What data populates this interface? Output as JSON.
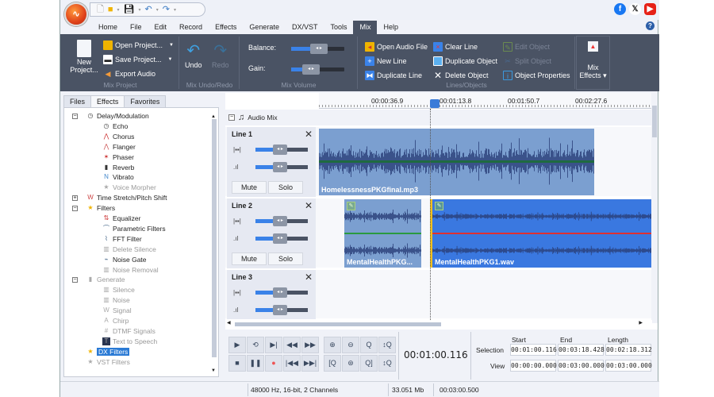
{
  "titlebar": {
    "qat_icons": [
      "new-file-icon",
      "open-folder-icon",
      "save-icon",
      "undo-icon",
      "redo-icon"
    ],
    "social": [
      "facebook",
      "x",
      "youtube"
    ]
  },
  "menu": {
    "items": [
      "Home",
      "File",
      "Edit",
      "Record",
      "Effects",
      "Generate",
      "DX/VST",
      "Tools",
      "Mix",
      "Help"
    ],
    "active": "Mix"
  },
  "ribbon": {
    "mix_project": {
      "new": "New Project...",
      "open": "Open Project...",
      "save": "Save Project...",
      "export": "Export Audio",
      "label": "Mix Project"
    },
    "undo_redo": {
      "undo": "Undo",
      "redo": "Redo",
      "label": "Mix Undo/Redo"
    },
    "mix_volume": {
      "balance": "Balance:",
      "gain": "Gain:",
      "label": "Mix Volume",
      "balance_value": 0.5,
      "gain_value": 0.4
    },
    "lines_objects": {
      "open_audio": "Open Audio File",
      "new_line": "New Line",
      "dup_line": "Duplicate Line",
      "clear_line": "Clear Line",
      "dup_object": "Duplicate Object",
      "delete_object": "Delete Object",
      "edit_object": "Edit Object",
      "split_object": "Split Object",
      "object_props": "Object Properties",
      "label": "Lines/Objects"
    },
    "mix_effects": {
      "line1": "Mix",
      "line2": "Effects ▾"
    }
  },
  "left": {
    "tabs": [
      "Files",
      "Effects",
      "Favorites"
    ],
    "active_tab": "Effects",
    "tree": [
      {
        "label": "Delay/Modulation",
        "level": 0,
        "icon": "clock-icon",
        "dim": false
      },
      {
        "label": "Echo",
        "level": 1,
        "icon": "clock-icon",
        "dim": false
      },
      {
        "label": "Chorus",
        "level": 1,
        "icon": "chorus-icon",
        "dim": false
      },
      {
        "label": "Flanger",
        "level": 1,
        "icon": "flanger-icon",
        "dim": false
      },
      {
        "label": "Phaser",
        "level": 1,
        "icon": "phaser-icon",
        "dim": false
      },
      {
        "label": "Reverb",
        "level": 1,
        "icon": "reverb-icon",
        "dim": false
      },
      {
        "label": "Vibrato",
        "level": 1,
        "icon": "vibrato-icon",
        "dim": false
      },
      {
        "label": "Voice Morpher",
        "level": 1,
        "icon": "star-icon",
        "dim": true
      },
      {
        "label": "Time Stretch/Pitch Shift",
        "level": 0,
        "icon": "stretch-icon",
        "dim": false
      },
      {
        "label": "Filters",
        "level": 0,
        "icon": "star-icon",
        "dim": false
      },
      {
        "label": "Equalizer",
        "level": 1,
        "icon": "equalizer-icon",
        "dim": false
      },
      {
        "label": "Parametric Filters",
        "level": 1,
        "icon": "parametric-icon",
        "dim": false
      },
      {
        "label": "FFT Filter",
        "level": 1,
        "icon": "fft-icon",
        "dim": false
      },
      {
        "label": "Delete Silence",
        "level": 1,
        "icon": "silence-icon",
        "dim": true
      },
      {
        "label": "Noise Gate",
        "level": 1,
        "icon": "gate-icon",
        "dim": false
      },
      {
        "label": "Noise Removal",
        "level": 1,
        "icon": "noise-icon",
        "dim": true
      },
      {
        "label": "Generate",
        "level": 0,
        "icon": "generate-icon",
        "dim": true
      },
      {
        "label": "Silence",
        "level": 1,
        "icon": "silence-icon",
        "dim": true
      },
      {
        "label": "Noise",
        "level": 1,
        "icon": "noise-icon",
        "dim": true
      },
      {
        "label": "Signal",
        "level": 1,
        "icon": "signal-icon",
        "dim": true
      },
      {
        "label": "Chirp",
        "level": 1,
        "icon": "chirp-icon",
        "dim": true
      },
      {
        "label": "DTMF Signals",
        "level": 1,
        "icon": "hash-icon",
        "dim": true
      },
      {
        "label": "Text to Speech",
        "level": 1,
        "icon": "tts-icon",
        "dim": true
      },
      {
        "label": "DX Filters",
        "level": 0,
        "icon": "dx-icon",
        "dim": false,
        "selected": true
      },
      {
        "label": "VST Filters",
        "level": 0,
        "icon": "vst-icon",
        "dim": true
      }
    ]
  },
  "timeline": {
    "ticks": [
      "00:00:36.9",
      "00:01:13.8",
      "00:01:50.7",
      "00:02:27.6"
    ],
    "audio_mix": "Audio Mix"
  },
  "lines": [
    {
      "name": "Line 1",
      "mute": "Mute",
      "solo": "Solo"
    },
    {
      "name": "Line 2",
      "mute": "Mute",
      "solo": "Solo"
    },
    {
      "name": "Line 3"
    }
  ],
  "clips": [
    {
      "name": "HomelessnessPKGfinal.mp3",
      "line": 1
    },
    {
      "name": "MentalHealthPKG...",
      "line": 2
    },
    {
      "name": "MentalHealthPKG1.wav",
      "line": 2,
      "selected": true
    }
  ],
  "transport": {
    "time": "00:01:00.116",
    "headers": [
      "Start",
      "End",
      "Length"
    ],
    "selection_label": "Selection",
    "view_label": "View",
    "selection": [
      "00:01:00.116",
      "00:03:18.428",
      "00:02:18.312"
    ],
    "view": [
      "00:00:00.000",
      "00:03:00.000",
      "00:03:00.000"
    ]
  },
  "status": {
    "format": "48000 Hz, 16-bit, 2 Channels",
    "size": "33.051 Mb",
    "duration": "00:03:00.500"
  }
}
